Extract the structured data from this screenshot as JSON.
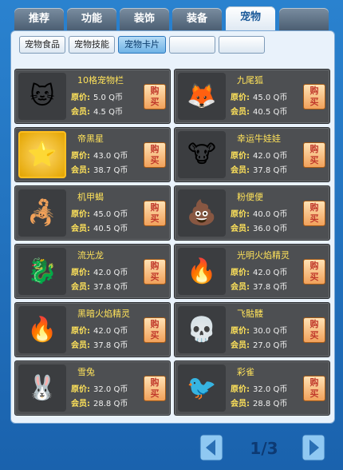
{
  "tabs": [
    "推荐",
    "功能",
    "装饰",
    "装备",
    "宠物",
    ""
  ],
  "active_tab_index": 4,
  "subtabs": [
    "宠物食品",
    "宠物技能",
    "宠物卡片",
    "",
    ""
  ],
  "active_subtab_index": 2,
  "price_label": "原价:",
  "member_label": "会员:",
  "buy_label": "购买",
  "items": [
    {
      "name": "10格宠物栏",
      "price": "5.0  Q币",
      "member": "4.5  Q币",
      "icon": "🐱",
      "selected": false
    },
    {
      "name": "九尾狐",
      "price": "45.0 Q币",
      "member": "40.5 Q币",
      "icon": "🦊",
      "selected": false
    },
    {
      "name": "帝黑星",
      "price": "43.0 Q币",
      "member": "38.7 Q币",
      "icon": "⭐",
      "selected": true
    },
    {
      "name": "幸运牛娃娃",
      "price": "42.0 Q币",
      "member": "37.8 Q币",
      "icon": "🐮",
      "selected": false
    },
    {
      "name": "机甲蝎",
      "price": "45.0 Q币",
      "member": "40.5 Q币",
      "icon": "🦂",
      "selected": false
    },
    {
      "name": "粉便便",
      "price": "40.0 Q币",
      "member": "36.0 Q币",
      "icon": "💩",
      "selected": false
    },
    {
      "name": "流光龙",
      "price": "42.0 Q币",
      "member": "37.8 Q币",
      "icon": "🐉",
      "selected": false
    },
    {
      "name": "光明火焰精灵",
      "price": "42.0 Q币",
      "member": "37.8 Q币",
      "icon": "🔥",
      "selected": false
    },
    {
      "name": "黑暗火焰精灵",
      "price": "42.0 Q币",
      "member": "37.8 Q币",
      "icon": "🔥",
      "selected": false
    },
    {
      "name": "飞骷髅",
      "price": "30.0 Q币",
      "member": "27.0 Q币",
      "icon": "💀",
      "selected": false
    },
    {
      "name": "雪兔",
      "price": "32.0 Q币",
      "member": "28.8 Q币",
      "icon": "🐰",
      "selected": false
    },
    {
      "name": "彩雀",
      "price": "32.0 Q币",
      "member": "28.8 Q币",
      "icon": "🐦",
      "selected": false
    }
  ],
  "pager": {
    "text": "1/3",
    "current": 1,
    "total": 3
  }
}
